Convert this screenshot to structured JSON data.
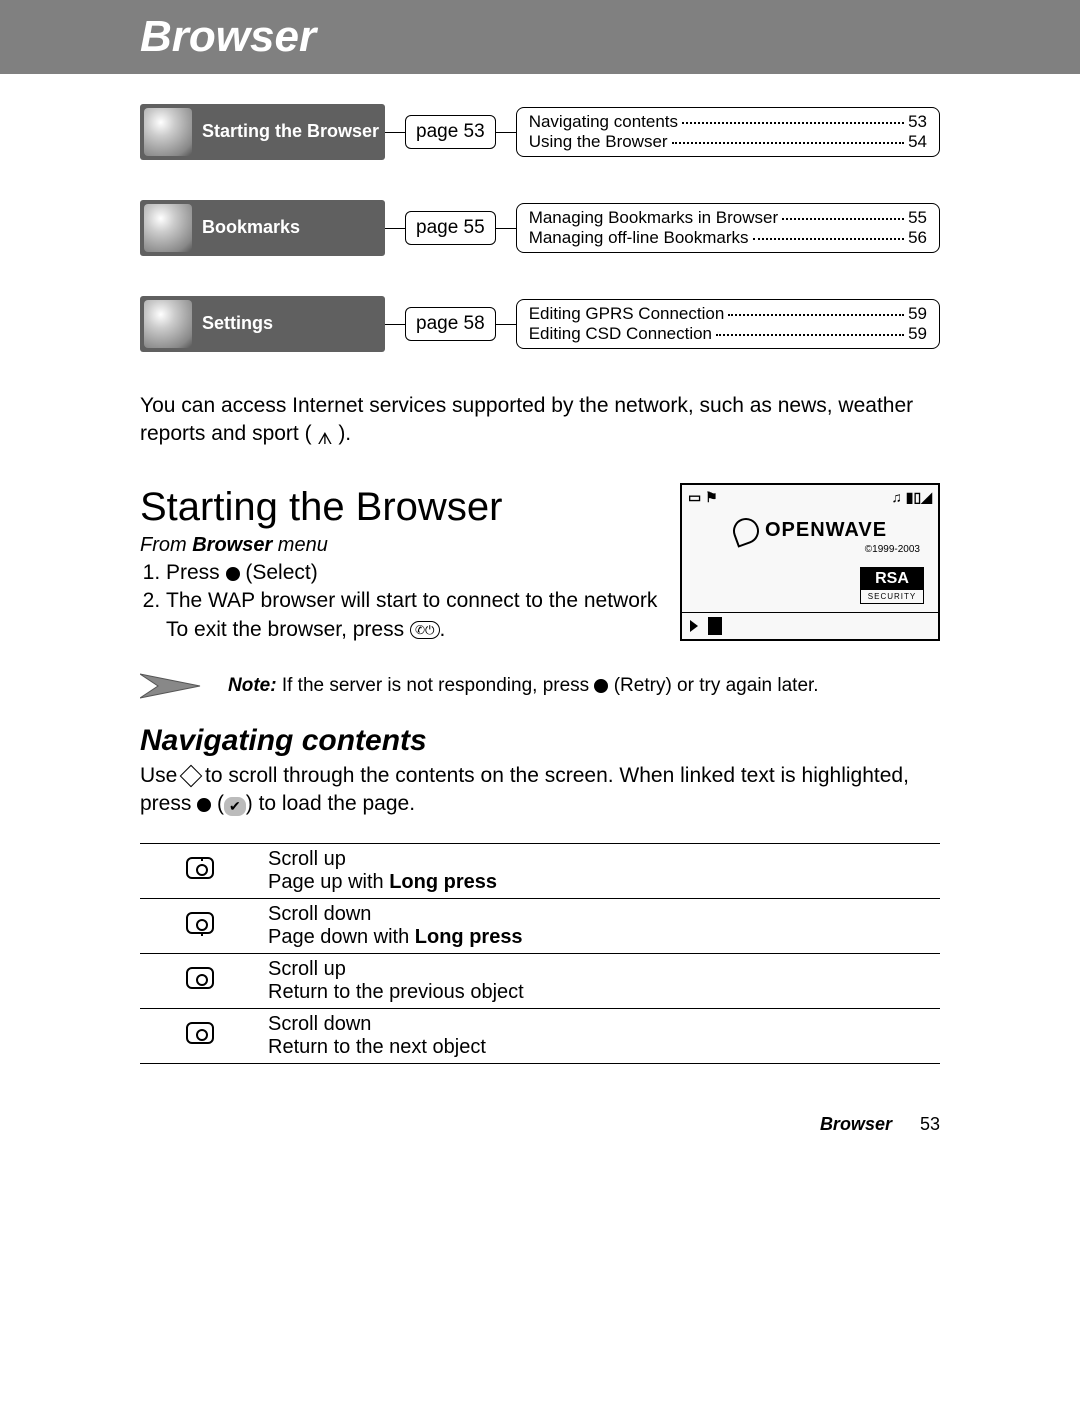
{
  "header": {
    "title": "Browser"
  },
  "topics": [
    {
      "label": "Starting the Browser",
      "page": "page 53",
      "subs": [
        {
          "name": "Navigating contents",
          "pg": "53"
        },
        {
          "name": "Using the Browser",
          "pg": "54"
        }
      ]
    },
    {
      "label": "Bookmarks",
      "page": "page 55",
      "subs": [
        {
          "name": "Managing Bookmarks in Browser",
          "pg": "55"
        },
        {
          "name": "Managing off-line Bookmarks",
          "pg": "56"
        }
      ]
    },
    {
      "label": "Settings",
      "page": "page 58",
      "subs": [
        {
          "name": "Editing GPRS Connection",
          "pg": "59"
        },
        {
          "name": "Editing CSD Connection",
          "pg": "59"
        }
      ]
    }
  ],
  "intro": {
    "before": "You can access Internet services supported by the network, such as news, weather reports and sport ( ",
    "after": " )."
  },
  "section1": {
    "title": "Starting the Browser",
    "from_prefix": "From ",
    "from_bold": "Browser",
    "from_suffix": " menu",
    "steps": {
      "s1_a": "Press ",
      "s1_b": " (Select)",
      "s2_a": "The WAP browser will start to connect to the network",
      "s2_b": "To exit the browser, press ",
      "s2_c": "."
    }
  },
  "phone": {
    "brand": "OPENWAVE",
    "copyright": "©1999-2003",
    "rsa": "RSA",
    "rsa_sub": "SECURITY"
  },
  "note": {
    "label": "Note:",
    "a": " If the server is not responding, press ",
    "b": " (Retry) or try again later."
  },
  "section2": {
    "title": "Navigating contents",
    "p_a": "Use ",
    "p_b": " to scroll through the contents on the screen. When linked text is highlighted, press ",
    "p_c": " (",
    "p_d": ") to load the page."
  },
  "nav_rows": [
    {
      "l1": "Scroll up",
      "l2a": "Page up with ",
      "l2b": "Long press"
    },
    {
      "l1": "Scroll down",
      "l2a": "Page down with ",
      "l2b": "Long press"
    },
    {
      "l1": "Scroll up",
      "l2a": "Return to the previous object",
      "l2b": ""
    },
    {
      "l1": "Scroll down",
      "l2a": "Return to the next object",
      "l2b": ""
    }
  ],
  "footer": {
    "name": "Browser",
    "page": "53"
  }
}
